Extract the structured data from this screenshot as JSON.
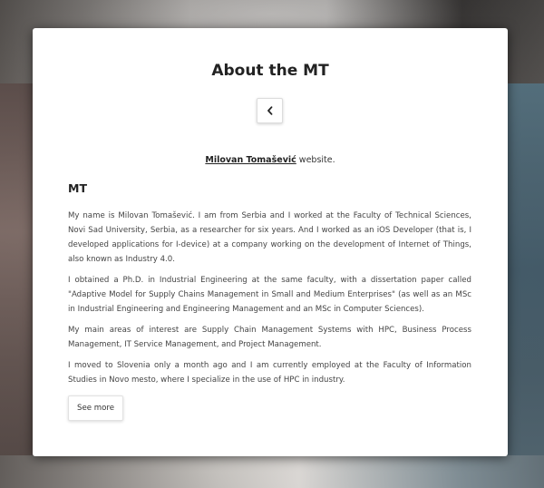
{
  "modal": {
    "title": "About the MT",
    "back_icon": "chevron-left-icon",
    "subtitle_link": "Milovan Tomašević",
    "subtitle_rest": " website.",
    "section_heading": "MT",
    "paragraphs": [
      "My name is Milovan Tomašević. I am from Serbia and I worked at the Faculty of Technical Sciences, Novi Sad University, Serbia, as a researcher for six years. And I worked as an iOS Developer (that is, I developed applications for I-device) at a company working on the development of Internet of Things, also known as Industry 4.0.",
      "I obtained a Ph.D. in Industrial Engineering at the same faculty, with a dissertation paper called \"Adaptive Model for Supply Chains Management in Small and Medium Enterprises\" (as well as an MSc in Industrial Engineering and Engineering Management and an MSc in Computer Sciences).",
      "My main areas of interest are Supply Chain Management Systems with HPC, Business Process Management, IT Service Management, and Project Management.",
      "I moved to Slovenia only a month ago and I am currently employed at the Faculty of Information Studies in Novo mesto, where I specialize in the use of HPC in industry."
    ],
    "see_more_label": "See more"
  },
  "colors": {
    "modal_background": "#ffffff",
    "text_dark": "#222222",
    "text_body": "#444444"
  }
}
